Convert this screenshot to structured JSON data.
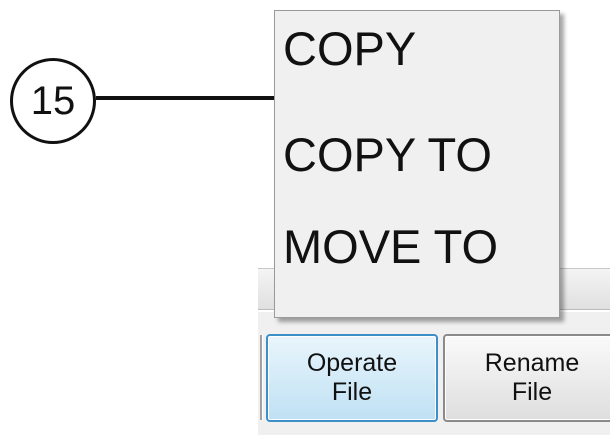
{
  "callout": {
    "number": "15"
  },
  "popup_menu": {
    "items": [
      {
        "label": "COPY"
      },
      {
        "label": "COPY TO"
      },
      {
        "label": "MOVE TO"
      }
    ]
  },
  "toolbar": {
    "buttons": [
      {
        "line1": "Operate",
        "line2": "File",
        "state": "selected"
      },
      {
        "line1": "Rename",
        "line2": "File",
        "state": "normal"
      }
    ]
  },
  "colors": {
    "selected_border": "#3c8fc8",
    "selected_fill": "#bfe1f4",
    "menu_background": "#f0f0f0"
  }
}
